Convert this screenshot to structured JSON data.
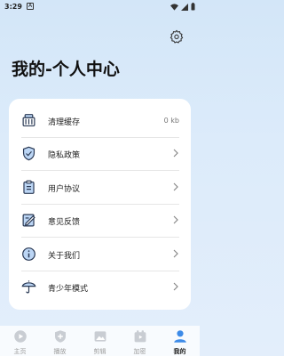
{
  "status_bar": {
    "time": "3:29",
    "notification": "A"
  },
  "header": {
    "title": "我的-个人中心",
    "settings_icon": "gear-icon"
  },
  "menu": [
    {
      "label": "清理缓存",
      "value": "0 kb",
      "icon": "broom-icon"
    },
    {
      "label": "隐私政策",
      "icon": "shield-icon"
    },
    {
      "label": "用户协议",
      "icon": "clipboard-icon"
    },
    {
      "label": "意见反馈",
      "icon": "edit-note-icon"
    },
    {
      "label": "关于我们",
      "icon": "info-icon"
    },
    {
      "label": "青少年模式",
      "icon": "umbrella-icon"
    }
  ],
  "tabs": [
    {
      "label": "主页",
      "icon": "play-icon",
      "active": false
    },
    {
      "label": "播放",
      "icon": "add-icon",
      "active": false
    },
    {
      "label": "剪辑",
      "icon": "image-icon",
      "active": false
    },
    {
      "label": "加密",
      "icon": "lock-video-icon",
      "active": false
    },
    {
      "label": "我的",
      "icon": "user-icon",
      "active": true
    }
  ],
  "colors": {
    "accent": "#3d8be8",
    "background": "#d8e8f8"
  }
}
